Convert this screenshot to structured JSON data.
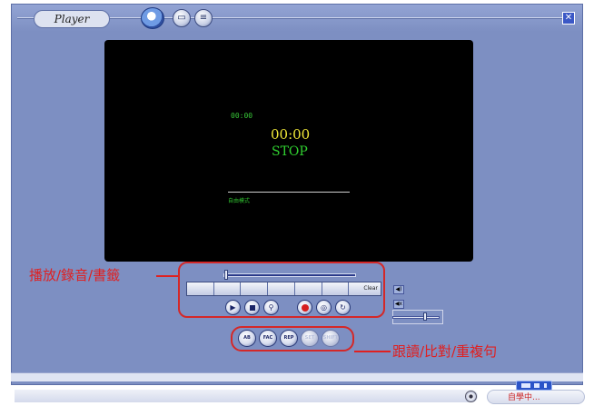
{
  "window": {
    "title": "Player"
  },
  "icons": {
    "logo": "player-logo-icon",
    "title_buttons": [
      "folder-icon",
      "list-icon"
    ],
    "close": "close-icon"
  },
  "screen": {
    "clock_small": "00:00",
    "clock_big": "00:00",
    "state": "STOP",
    "mode_label": "自由模式"
  },
  "controls": {
    "clear_label": "Clear",
    "transport_buttons": [
      "play",
      "stop",
      "speed",
      "record",
      "playback",
      "repeat"
    ],
    "mode_buttons": [
      {
        "label": "AB",
        "enabled": true
      },
      {
        "label": "FAC",
        "enabled": true
      },
      {
        "label": "REP",
        "enabled": true
      },
      {
        "label": "SET",
        "enabled": false
      },
      {
        "label": "SHIFT",
        "enabled": false
      }
    ]
  },
  "annotations": {
    "left": "播放/錄音/書籤",
    "right": "跟讀/比對/重複句"
  },
  "status": {
    "text": "自學中..."
  },
  "colors": {
    "panel": "#7d8fc2",
    "screen": "#000000",
    "clock_small": "#38c838",
    "clock_big": "#f0e838",
    "annotation": "#e02020"
  }
}
